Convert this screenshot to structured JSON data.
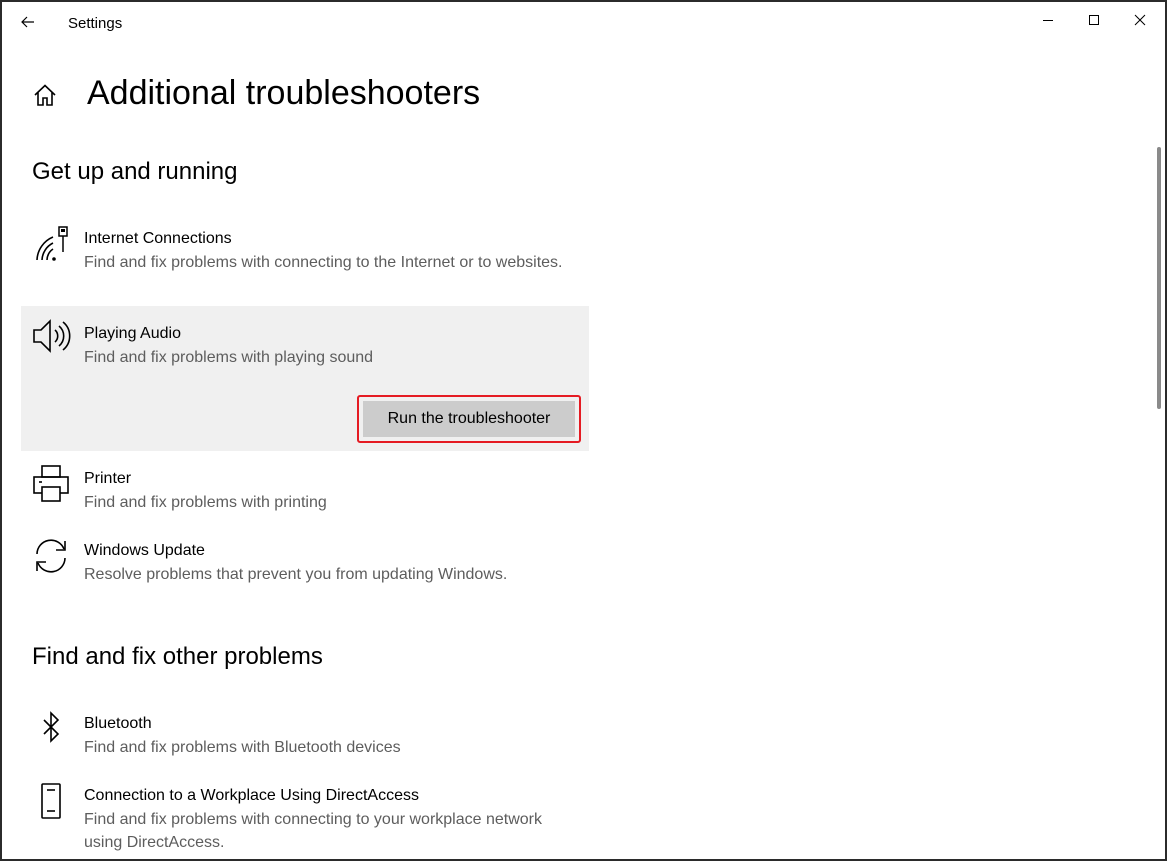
{
  "window": {
    "title": "Settings"
  },
  "page": {
    "title": "Additional troubleshooters"
  },
  "sections": {
    "get_up": {
      "title": "Get up and running",
      "items": [
        {
          "name": "Internet Connections",
          "description": "Find and fix problems with connecting to the Internet or to websites.",
          "icon": "wifi-network-icon"
        },
        {
          "name": "Playing Audio",
          "description": "Find and fix problems with playing sound",
          "icon": "speaker-icon",
          "selected": true,
          "run_label": "Run the troubleshooter"
        },
        {
          "name": "Printer",
          "description": "Find and fix problems with printing",
          "icon": "printer-icon"
        },
        {
          "name": "Windows Update",
          "description": "Resolve problems that prevent you from updating Windows.",
          "icon": "sync-icon"
        }
      ]
    },
    "other": {
      "title": "Find and fix other problems",
      "items": [
        {
          "name": "Bluetooth",
          "description": "Find and fix problems with Bluetooth devices",
          "icon": "bluetooth-icon"
        },
        {
          "name": "Connection to a Workplace Using DirectAccess",
          "description": "Find and fix problems with connecting to your workplace network using DirectAccess.",
          "icon": "phone-device-icon"
        }
      ]
    }
  },
  "colors": {
    "highlight_border": "#e51b23",
    "selected_bg": "#f0f0f0",
    "button_bg": "#cccccc",
    "secondary_text": "#5d5d5d"
  }
}
